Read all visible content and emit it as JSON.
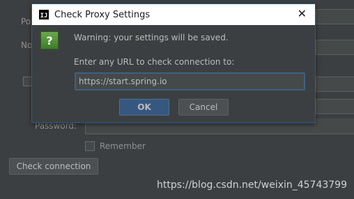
{
  "background": {
    "port_label_partial": "Po",
    "no_proxy_label_partial": "No",
    "password_label": "Password:",
    "remember_label": "Remember",
    "check_connection_label": "Check connection"
  },
  "dialog": {
    "title": "Check Proxy Settings",
    "close_glyph": "✕",
    "app_icon_text": "IJ",
    "help_icon_text": "?",
    "warning_text": "Warning: your settings will be saved.",
    "prompt_text": "Enter any URL to check connection to:",
    "url_value": "https://start.spring.io",
    "ok_label": "OK",
    "cancel_label": "Cancel"
  },
  "watermark": "https://blog.csdn.net/weixin_45743799"
}
